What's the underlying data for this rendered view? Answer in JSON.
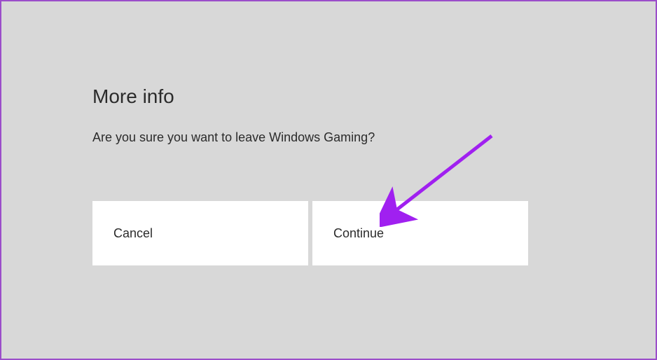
{
  "dialog": {
    "heading": "More info",
    "message": "Are you sure you want to leave Windows Gaming?",
    "cancel_label": "Cancel",
    "continue_label": "Continue"
  },
  "annotation": {
    "arrow_color": "#a020f0"
  }
}
